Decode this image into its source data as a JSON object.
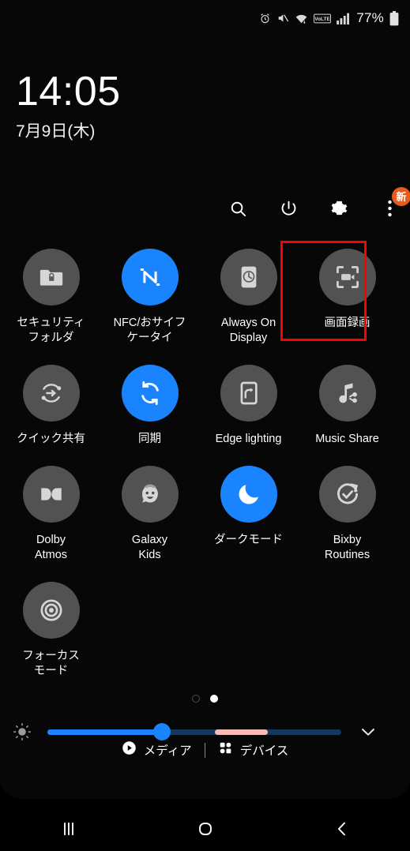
{
  "status_bar": {
    "icons": [
      "alarm-icon",
      "mute-icon",
      "wifi-icon",
      "volte-icon",
      "signal-icon"
    ],
    "battery_percent": "77%",
    "battery_icon": "battery-icon"
  },
  "clock": {
    "time": "14:05",
    "date": "7月9日(木)"
  },
  "header": {
    "buttons": [
      {
        "name": "search-button",
        "icon": "search-icon"
      },
      {
        "name": "power-button",
        "icon": "power-icon"
      },
      {
        "name": "settings-button",
        "icon": "gear-icon"
      },
      {
        "name": "more-options-button",
        "icon": "three-dots-icon",
        "badge": "新"
      }
    ]
  },
  "tiles": [
    {
      "label": "セキュリティ\nフォルダ",
      "icon": "lock-folder-icon",
      "active": false,
      "highlighted": false,
      "name": "tile-secure-folder"
    },
    {
      "label": "NFC/おサイフ\nケータイ",
      "icon": "nfc-icon",
      "active": true,
      "highlighted": false,
      "name": "tile-nfc"
    },
    {
      "label": "Always On\nDisplay",
      "icon": "always-on-display-icon",
      "active": false,
      "highlighted": false,
      "name": "tile-always-on-display"
    },
    {
      "label": "画面録画",
      "icon": "screen-record-icon",
      "active": false,
      "highlighted": true,
      "name": "tile-screen-record"
    },
    {
      "label": "クイック共有",
      "icon": "quick-share-icon",
      "active": false,
      "highlighted": false,
      "name": "tile-quick-share"
    },
    {
      "label": "同期",
      "icon": "sync-icon",
      "active": true,
      "highlighted": false,
      "name": "tile-sync"
    },
    {
      "label": "Edge lighting",
      "icon": "edge-lighting-icon",
      "active": false,
      "highlighted": false,
      "name": "tile-edge-lighting"
    },
    {
      "label": "Music Share",
      "icon": "music-share-icon",
      "active": false,
      "highlighted": false,
      "name": "tile-music-share"
    },
    {
      "label": "Dolby\nAtmos",
      "icon": "dolby-atmos-icon",
      "active": false,
      "highlighted": false,
      "name": "tile-dolby-atmos"
    },
    {
      "label": "Galaxy\nKids",
      "icon": "galaxy-kids-icon",
      "active": false,
      "highlighted": false,
      "name": "tile-galaxy-kids"
    },
    {
      "label": "ダークモード",
      "icon": "moon-icon",
      "active": true,
      "highlighted": false,
      "name": "tile-dark-mode"
    },
    {
      "label": "Bixby\nRoutines",
      "icon": "bixby-routines-icon",
      "active": false,
      "highlighted": false,
      "name": "tile-bixby-routines"
    },
    {
      "label": "フォーカス\nモード",
      "icon": "focus-mode-icon",
      "active": false,
      "highlighted": false,
      "name": "tile-focus-mode"
    }
  ],
  "pager": {
    "total_pages": 2,
    "active_page": 2
  },
  "brightness": {
    "icon": "brightness-icon",
    "value_percent": 39,
    "pink_segment_start_percent": 57,
    "pink_segment_end_percent": 75,
    "expand_icon": "chevron-down-icon"
  },
  "footer": {
    "media_label": "メディア",
    "media_icon": "play-icon",
    "devices_label": "デバイス",
    "devices_icon": "grid-dots-icon"
  },
  "navbar": {
    "recents": "recents-icon",
    "home": "home-icon",
    "back": "back-icon"
  },
  "colors": {
    "accent_blue": "#1a84ff",
    "tile_off": "#525252",
    "badge_orange": "#e8591b",
    "highlight_red": "#ff0000",
    "pink_segment": "#f7bcb4"
  }
}
